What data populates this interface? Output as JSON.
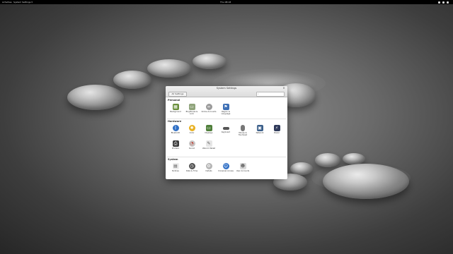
{
  "topbar": {
    "activities": "Activities",
    "app_menu": "System Settings ▾",
    "clock": "Thu 08:18"
  },
  "window": {
    "title": "System Settings",
    "all_settings_label": "All Settings",
    "search_placeholder": ""
  },
  "sections": {
    "personal": "Personal",
    "hardware": "Hardware",
    "system": "System"
  },
  "items": {
    "background": "Background",
    "brightness": "Brightness & Lock",
    "online_accounts": "Online Accounts",
    "region": "Region & Language",
    "bluetooth": "Bluetooth",
    "color": "Color",
    "displays": "Displays",
    "keyboard": "Keyboard",
    "mouse": "Mouse & Touchpad",
    "network": "Network",
    "power": "Power",
    "printers": "Printers",
    "sound": "Sound",
    "wacom": "Wacom Tablet",
    "notice": "Notices",
    "datetime": "Date & Time",
    "details": "Details",
    "universal_access": "Universal Access",
    "users": "User Accounts"
  }
}
